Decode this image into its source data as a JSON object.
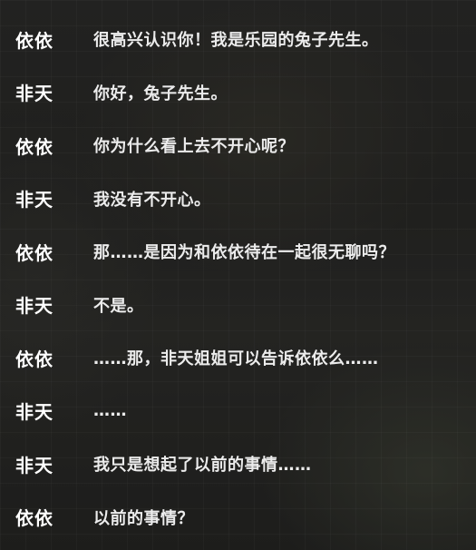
{
  "dialogue_log": {
    "entries": [
      {
        "speaker": "依依",
        "text": "很高兴认识你！我是乐园的兔子先生。"
      },
      {
        "speaker": "非天",
        "text": "你好，兔子先生。"
      },
      {
        "speaker": "依依",
        "text": "你为什么看上去不开心呢？"
      },
      {
        "speaker": "非天",
        "text": "我没有不开心。"
      },
      {
        "speaker": "依依",
        "text": "那……是因为和依依待在一起很无聊吗？"
      },
      {
        "speaker": "非天",
        "text": "不是。"
      },
      {
        "speaker": "依依",
        "text": "……那，非天姐姐可以告诉依依么……"
      },
      {
        "speaker": "非天",
        "text": "……"
      },
      {
        "speaker": "非天",
        "text": "我只是想起了以前的事情……"
      },
      {
        "speaker": "依依",
        "text": "以前的事情？"
      }
    ]
  }
}
